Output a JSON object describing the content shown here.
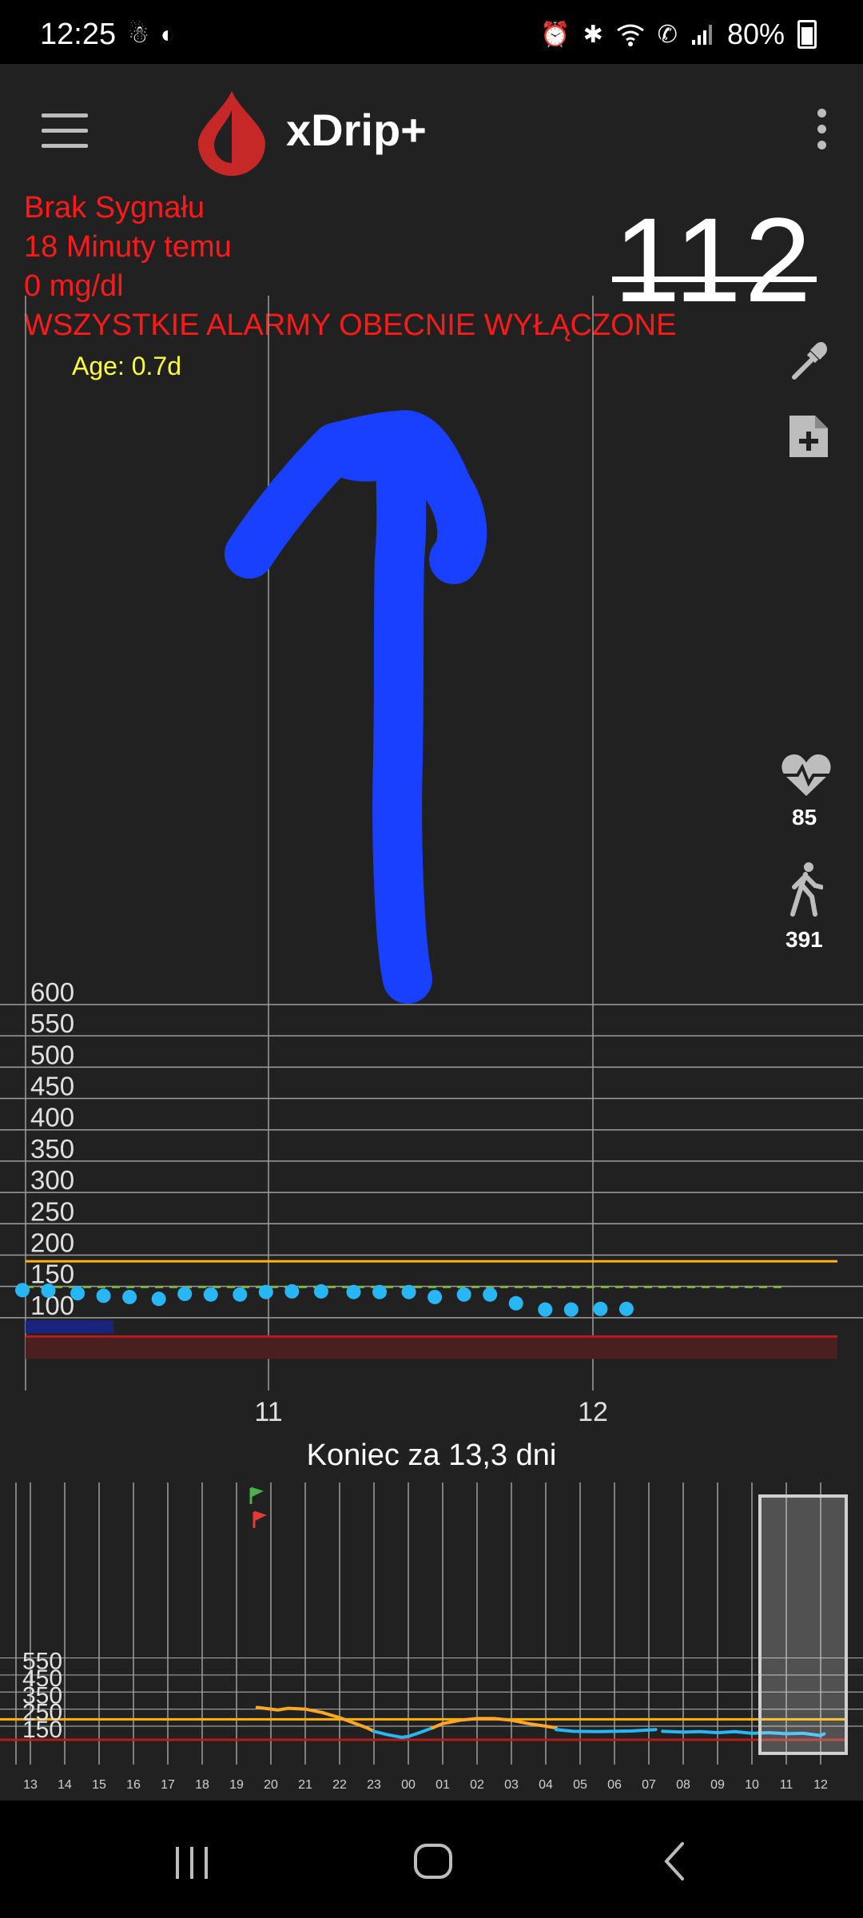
{
  "status_bar": {
    "time": "12:25",
    "battery": "80%",
    "left_icons": [
      "notification-icon",
      "dark-mode-icon"
    ],
    "right_icons": [
      "alarm-icon",
      "bluetooth-icon",
      "wifi-icon",
      "wifi-calling-icon",
      "signal-icon",
      "battery-icon"
    ]
  },
  "app_bar": {
    "title": "xDrip+",
    "menu_icon": "hamburger-menu-icon",
    "logo_icon": "blood-drop-icon",
    "overflow_icon": "more-vert-icon"
  },
  "status": {
    "signal": "Brak Sygnału",
    "last_reading": "18 Minuty temu",
    "delta": "0 mg/dl",
    "alarms": " WSZYSTKIE ALARMY OBECNIE WYŁĄCZONE",
    "age": "Age: 0.7d"
  },
  "bg_reading": {
    "value": "112",
    "stale": true
  },
  "side_actions": {
    "blood_test_icon": "eyedropper-icon",
    "treatment_icon": "note-add-icon",
    "heart_rate_icon": "heart-rate-icon",
    "heart_rate": "85",
    "steps_icon": "walking-icon",
    "steps": "391"
  },
  "colors": {
    "alarm_text": "#ff1a1a",
    "age_text": "#ffff3a",
    "high_line": "#ffb300",
    "low_line": "#b71c1c",
    "target_line": "#7cb342",
    "bg_dots": "#29b6f6",
    "annotation_arrow": "#1a40ff",
    "logo": "#c62828"
  },
  "chart_data": [
    {
      "type": "scatter",
      "y_ticks": [
        "600",
        "550",
        "500",
        "450",
        "400",
        "350",
        "300",
        "250",
        "200",
        "150",
        "100"
      ],
      "ylim": [
        50,
        600
      ],
      "x_ticks": [
        "11",
        "12"
      ],
      "xlim": [
        10.25,
        12.75
      ],
      "high_line": 190,
      "low_line": 70,
      "target_line": 149,
      "points": [
        {
          "x": 10.25,
          "y": 144
        },
        {
          "x": 10.33,
          "y": 143
        },
        {
          "x": 10.42,
          "y": 139
        },
        {
          "x": 10.5,
          "y": 135
        },
        {
          "x": 10.58,
          "y": 133
        },
        {
          "x": 10.67,
          "y": 130
        },
        {
          "x": 10.75,
          "y": 138
        },
        {
          "x": 10.83,
          "y": 137
        },
        {
          "x": 10.92,
          "y": 137
        },
        {
          "x": 11.0,
          "y": 141
        },
        {
          "x": 11.08,
          "y": 142
        },
        {
          "x": 11.17,
          "y": 142
        },
        {
          "x": 11.27,
          "y": 141
        },
        {
          "x": 11.35,
          "y": 141
        },
        {
          "x": 11.44,
          "y": 141
        },
        {
          "x": 11.52,
          "y": 133
        },
        {
          "x": 11.61,
          "y": 137
        },
        {
          "x": 11.69,
          "y": 137
        },
        {
          "x": 11.77,
          "y": 123
        },
        {
          "x": 11.86,
          "y": 113
        },
        {
          "x": 11.94,
          "y": 113
        },
        {
          "x": 12.03,
          "y": 114
        },
        {
          "x": 12.11,
          "y": 114
        }
      ]
    },
    {
      "type": "line",
      "title": "Koniec za 13,3 dni",
      "y_ticks": [
        "550",
        "450",
        "350",
        "250",
        "150"
      ],
      "x_ticks": [
        "13",
        "14",
        "15",
        "16",
        "17",
        "18",
        "19",
        "20",
        "21",
        "22",
        "23",
        "00",
        "01",
        "02",
        "03",
        "04",
        "05",
        "06",
        "07",
        "08",
        "09",
        "10",
        "11",
        "12"
      ],
      "ylim": [
        0,
        600
      ],
      "series": [
        {
          "color": "#ffa726",
          "x": [
            19.6,
            20.0,
            20.2,
            20.5,
            21.0,
            21.5,
            22.0,
            22.4,
            22.8,
            23.0
          ],
          "y": [
            260,
            250,
            245,
            255,
            250,
            230,
            200,
            170,
            140,
            120
          ]
        },
        {
          "color": "#29b6f6",
          "x": [
            23.0,
            23.4,
            23.8,
            24.0,
            24.3,
            24.7
          ],
          "y": [
            120,
            100,
            85,
            90,
            110,
            140
          ]
        },
        {
          "color": "#ffa726",
          "x": [
            24.7,
            25.0,
            25.5,
            26.0,
            26.5,
            27.0,
            27.5,
            28.0,
            28.3
          ],
          "y": [
            140,
            165,
            185,
            195,
            195,
            185,
            165,
            150,
            140
          ]
        },
        {
          "color": "#29b6f6",
          "x": [
            28.3,
            28.8,
            29.5,
            30.0,
            30.5,
            31.0,
            31.2
          ],
          "y": [
            130,
            120,
            118,
            120,
            122,
            128,
            130
          ]
        },
        {
          "color": "#29b6f6",
          "x": [
            31.4,
            32.0,
            32.5,
            33.0,
            33.5,
            34.0,
            34.5,
            35.0,
            35.5,
            36.0,
            36.1
          ],
          "y": [
            120,
            115,
            118,
            112,
            118,
            108,
            112,
            106,
            108,
            95,
            105
          ]
        }
      ]
    }
  ]
}
